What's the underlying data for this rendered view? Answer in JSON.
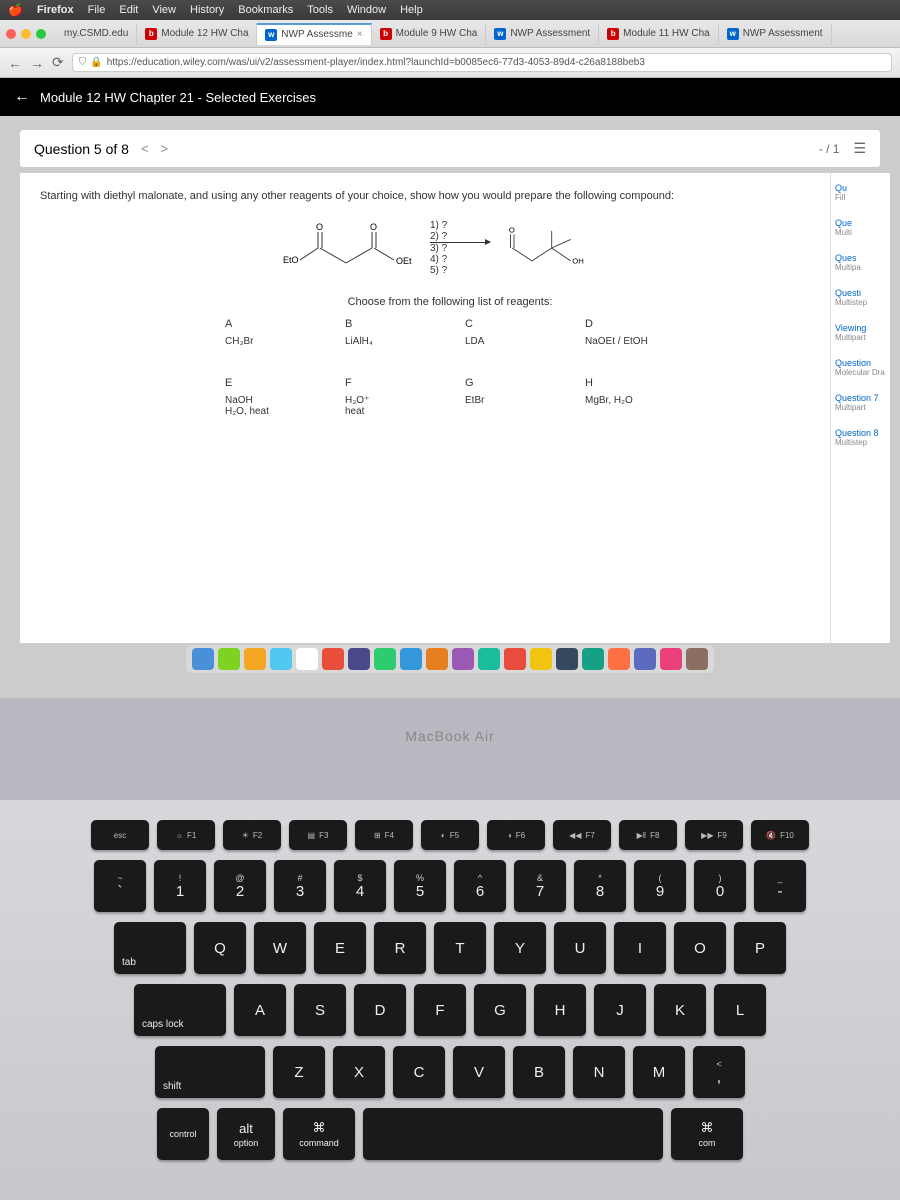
{
  "menubar": {
    "app": "Firefox",
    "items": [
      "File",
      "Edit",
      "View",
      "History",
      "Bookmarks",
      "Tools",
      "Window",
      "Help"
    ]
  },
  "tabs": [
    {
      "ico": "",
      "label": "my.CSMD.edu"
    },
    {
      "ico": "b2l",
      "label": "Module 12 HW Cha"
    },
    {
      "ico": "wp",
      "label": "NWP Assessme",
      "active": true
    },
    {
      "ico": "b2l",
      "label": "Module 9 HW Cha"
    },
    {
      "ico": "wp",
      "label": "NWP Assessment"
    },
    {
      "ico": "b2l",
      "label": "Module 11 HW Cha"
    },
    {
      "ico": "wp",
      "label": "NWP Assessment"
    }
  ],
  "url": "https://education.wiley.com/was/ui/v2/assessment-player/index.html?launchId=b0085ec6-77d3-4053-89d4-c26a8188beb3",
  "page_title": "Module 12 HW Chapter 21 - Selected Exercises",
  "question": {
    "label": "Question 5 of 8",
    "score": "- / 1",
    "instruction": "Starting with diethyl malonate, and using any other reagents of your choice, show how you would prepare the following compound:",
    "start_left": "EtO",
    "start_right": "OEt",
    "steps_top": [
      "1) ?",
      "2) ?"
    ],
    "steps_bottom": [
      "3) ?",
      "4) ?",
      "5) ?"
    ],
    "product_right": "OH",
    "choose": "Choose from the following list of reagents:",
    "reagents": [
      {
        "l": "A",
        "c": "CH₃Br"
      },
      {
        "l": "B",
        "c": "LiAlH₄"
      },
      {
        "l": "C",
        "c": "LDA"
      },
      {
        "l": "D",
        "c": "NaOEt / EtOH"
      },
      {
        "l": "E",
        "c": "NaOH\nH₂O, heat"
      },
      {
        "l": "F",
        "c": "H₃O⁺\nheat"
      },
      {
        "l": "G",
        "c": "EtBr"
      },
      {
        "l": "H",
        "c": "MgBr, H₂O"
      }
    ]
  },
  "sidebar_items": [
    {
      "t": "Qu",
      "s": "Fill"
    },
    {
      "t": "Que",
      "s": "Multi"
    },
    {
      "t": "Ques",
      "s": "Multipa"
    },
    {
      "t": "Questi",
      "s": "Multistep"
    },
    {
      "t": "Viewing",
      "s": "Multipart"
    },
    {
      "t": "Question",
      "s": "Molecular Dra"
    },
    {
      "t": "Question 7",
      "s": "Multipart"
    },
    {
      "t": "Question 8",
      "s": "Multistep"
    }
  ],
  "macbook": "MacBook Air",
  "keys": {
    "fn": [
      {
        "l": "esc",
        "i": ""
      },
      {
        "l": "F1",
        "i": "☼"
      },
      {
        "l": "F2",
        "i": "☀"
      },
      {
        "l": "F3",
        "i": "▤"
      },
      {
        "l": "F4",
        "i": "⊞"
      },
      {
        "l": "F5",
        "i": "◐"
      },
      {
        "l": "F6",
        "i": "◑"
      },
      {
        "l": "F7",
        "i": "◀◀"
      },
      {
        "l": "F8",
        "i": "▶‖"
      },
      {
        "l": "F9",
        "i": "▶▶"
      },
      {
        "l": "F10",
        "i": "🔇"
      }
    ],
    "num": [
      {
        "t": "~",
        "m": "`"
      },
      {
        "t": "!",
        "m": "1"
      },
      {
        "t": "@",
        "m": "2"
      },
      {
        "t": "#",
        "m": "3"
      },
      {
        "t": "$",
        "m": "4"
      },
      {
        "t": "%",
        "m": "5"
      },
      {
        "t": "^",
        "m": "6"
      },
      {
        "t": "&",
        "m": "7"
      },
      {
        "t": "*",
        "m": "8"
      },
      {
        "t": "(",
        "m": "9"
      },
      {
        "t": ")",
        "m": "0"
      },
      {
        "t": "_",
        "m": "-"
      }
    ],
    "r1": [
      "Q",
      "W",
      "E",
      "R",
      "T",
      "Y",
      "U",
      "I",
      "O",
      "P"
    ],
    "r2": [
      "A",
      "S",
      "D",
      "F",
      "G",
      "H",
      "J",
      "K",
      "L"
    ],
    "r3": [
      "Z",
      "X",
      "C",
      "V",
      "B",
      "N",
      "M"
    ],
    "tab": "tab",
    "caps": "caps lock",
    "shift": "shift",
    "ctrl": "control",
    "opt": "option",
    "alt": "alt",
    "cmd": "command",
    "com_r": "com"
  }
}
